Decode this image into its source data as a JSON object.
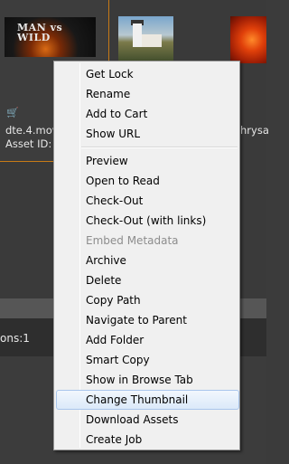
{
  "thumbnails": {
    "movie_title": "MAN vs WILD",
    "cart_icon": "shopping-cart-icon",
    "filename_1": "dte.4.mov",
    "asset_id_1": "Asset ID:",
    "filename_3": "hrysa",
    "colors": {
      "selected_border": "#c77a16"
    }
  },
  "status": {
    "label": "ons:1"
  },
  "context_menu": {
    "items": [
      {
        "label": "Get Lock"
      },
      {
        "label": "Rename"
      },
      {
        "label": "Add to Cart"
      },
      {
        "label": "Show URL"
      },
      {
        "label": "Preview"
      },
      {
        "label": "Open to Read"
      },
      {
        "label": "Check-Out"
      },
      {
        "label": "Check-Out (with links)"
      },
      {
        "label": "Embed Metadata"
      },
      {
        "label": "Archive"
      },
      {
        "label": "Delete"
      },
      {
        "label": "Copy Path"
      },
      {
        "label": "Navigate to Parent"
      },
      {
        "label": "Add Folder"
      },
      {
        "label": "Smart Copy"
      },
      {
        "label": "Show in Browse Tab"
      },
      {
        "label": "Change Thumbnail"
      },
      {
        "label": "Download Assets"
      },
      {
        "label": "Create Job"
      }
    ],
    "disabled_item": "Embed Metadata",
    "highlighted_item": "Change Thumbnail",
    "colors": {
      "highlight": "#dbe9f9",
      "disabled_text": "#8d8d8d"
    }
  }
}
